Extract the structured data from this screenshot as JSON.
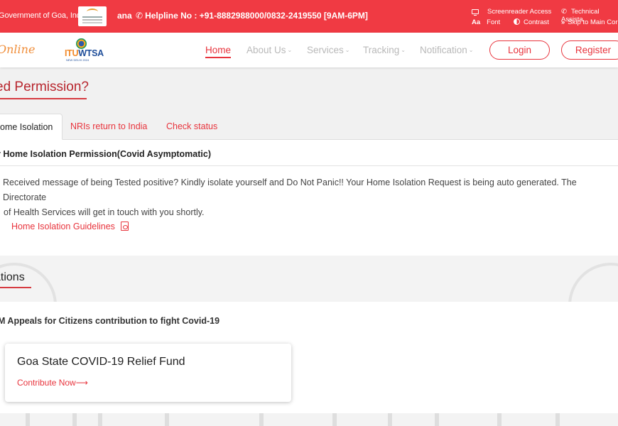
{
  "topbar": {
    "gov_text": "Government of Goa, India",
    "ana_text": "ana",
    "helpline": "Helpline No : +91-8882988000/0832-2419550 [9AM-6PM]",
    "screenreader": "Screenreader Access",
    "technical": "Technical Assista",
    "font_icon": "Aa",
    "font": "Font",
    "contrast": "Contrast",
    "skip": "Skip to Main Cor"
  },
  "navbar": {
    "logo_text": "Online",
    "itu_prefix": "ITU",
    "itu_suffix": "WTSA",
    "itu_sub": "NEW DELHI 2024",
    "items": [
      {
        "label": "Home",
        "has_menu": false
      },
      {
        "label": "About Us",
        "has_menu": true
      },
      {
        "label": "Services",
        "has_menu": true
      },
      {
        "label": "Tracking",
        "has_menu": true
      },
      {
        "label": "Notification",
        "has_menu": true
      }
    ],
    "login": "Login",
    "register": "Register"
  },
  "page": {
    "heading": "ed Permission?",
    "tabs": [
      "ome Isolation",
      "NRIs return to India",
      "Check status"
    ],
    "panel_title": "r Home Isolation Permission(Covid Asymptomatic)",
    "panel_text_1": "Received message of being Tested positive? Kindly isolate yourself and Do Not Panic!! Your Home Isolation Request is being auto generated. The Directorate",
    "panel_text_2": "of Health Services will get in touch with you shortly.",
    "guidelines_link": "Home Isolation Guidelines",
    "section2_heading": "ations",
    "appeal_text": "M Appeals for Citizens contribution to fight Covid-19",
    "card_title": "Goa State COVID-19 Relief Fund",
    "card_link": "Contribute Now⟶"
  },
  "colors": {
    "brand_red": "#f03a43",
    "accent_red": "#e8343d"
  },
  "icons": [
    "phone-icon",
    "monitor-icon",
    "phone-icon",
    "contrast-icon",
    "chevron-down-icon",
    "pdf-icon"
  ]
}
